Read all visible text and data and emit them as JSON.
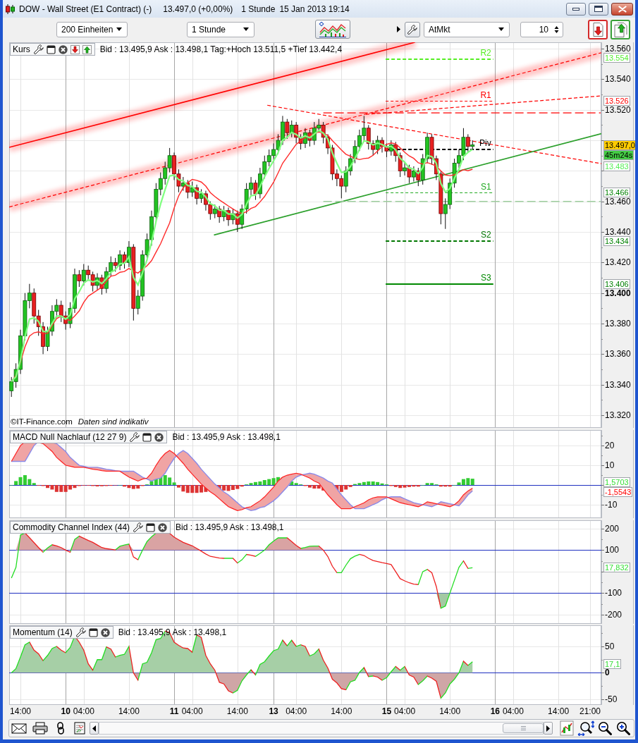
{
  "window": {
    "title": "DOW - Wall Street (E1 Contract) (-)",
    "quote": "13.497,0 (+0,00%)",
    "interval": "1 Stunde",
    "timestamp": "15 Jan 2013 19:14"
  },
  "toolbar": {
    "units": "200 Einheiten",
    "period": "1 Stunde",
    "order_type": "AtMkt",
    "quantity": "10"
  },
  "panels": [
    {
      "kind": "price",
      "label": "Kurs",
      "trade_buttons": true,
      "info": "Bid : 13.495,9 Ask : 13.498,1 Tag:+Hoch 13.511,5 +Tief 13.442,4",
      "copyright": "©IT-Finance.com",
      "disclaimer": "Daten sind indikativ",
      "axis_labels": [
        "13.560",
        "13.540",
        "13.520",
        "13.460",
        "13.440",
        "13.420",
        "13.400",
        "13.380",
        "13.360",
        "13.340",
        "13.320"
      ],
      "pivot_labels": [
        {
          "text": "R2",
          "color": "#55ee22"
        },
        {
          "text": "R1",
          "color": "#ff0000"
        },
        {
          "text": "Piv",
          "color": "#000000"
        },
        {
          "text": "S1",
          "color": "#22aa22"
        },
        {
          "text": "S2",
          "color": "#007700"
        },
        {
          "text": "S3",
          "color": "#008800"
        }
      ],
      "price_tags": [
        {
          "kind": "value",
          "text": "13.554",
          "color": "#55ee33"
        },
        {
          "kind": "value",
          "text": "13.526",
          "color": "#ff0000"
        },
        {
          "kind": "current",
          "text": "13.497,0",
          "color": "#ffcc00"
        },
        {
          "kind": "countdown",
          "text": "45m24s",
          "color": "#44cc44"
        },
        {
          "kind": "value",
          "text": "13.483",
          "color": "#55ee55"
        },
        {
          "kind": "value",
          "text": "13.466",
          "color": "#008000"
        },
        {
          "kind": "value",
          "text": "13.434",
          "color": "#008000"
        },
        {
          "kind": "value",
          "text": "13.406",
          "color": "#008000"
        }
      ]
    },
    {
      "kind": "macd",
      "label": "MACD Null Nachlauf (12 27 9)",
      "trade_buttons": false,
      "info": "Bid : 13.495,9 Ask : 13.498,1",
      "axis_labels": [
        "20",
        "10",
        "-10"
      ],
      "price_tags": [
        {
          "kind": "value",
          "text": "1,5703",
          "color": "#33dd33"
        },
        {
          "kind": "value",
          "text": "-1,5543",
          "color": "#ff0000"
        }
      ]
    },
    {
      "kind": "cci",
      "label": "Commodity Channel Index (44)",
      "trade_buttons": false,
      "info": "Bid : 13.495,9 Ask : 13.498,1",
      "axis_labels": [
        "200",
        "100",
        "-100",
        "-200"
      ],
      "price_tags": [
        {
          "kind": "value",
          "text": "17,832",
          "color": "#33dd33"
        }
      ]
    },
    {
      "kind": "momentum",
      "label": "Momentum (14)",
      "trade_buttons": false,
      "info": "Bid : 13.495,9 Ask : 13.498,1",
      "axis_labels": [
        "50",
        "0",
        "-50"
      ],
      "price_tags": [
        {
          "kind": "value",
          "text": "17,1",
          "color": "#33dd33"
        }
      ]
    }
  ],
  "time_axis": [
    {
      "kind": "time",
      "text": "14:00"
    },
    {
      "kind": "date",
      "text": "10"
    },
    {
      "kind": "time",
      "text": "04:00"
    },
    {
      "kind": "time",
      "text": "14:00"
    },
    {
      "kind": "date",
      "text": "11"
    },
    {
      "kind": "time",
      "text": "04:00"
    },
    {
      "kind": "time",
      "text": "14:00"
    },
    {
      "kind": "date",
      "text": "13"
    },
    {
      "kind": "time",
      "text": "04:00"
    },
    {
      "kind": "time",
      "text": "14:00"
    },
    {
      "kind": "date",
      "text": "15"
    },
    {
      "kind": "time",
      "text": "04:00"
    },
    {
      "kind": "time",
      "text": "14:00"
    },
    {
      "kind": "date",
      "text": "16"
    },
    {
      "kind": "time",
      "text": "04:00"
    },
    {
      "kind": "time",
      "text": "14:00"
    },
    {
      "kind": "time",
      "text": "21:00"
    }
  ]
}
